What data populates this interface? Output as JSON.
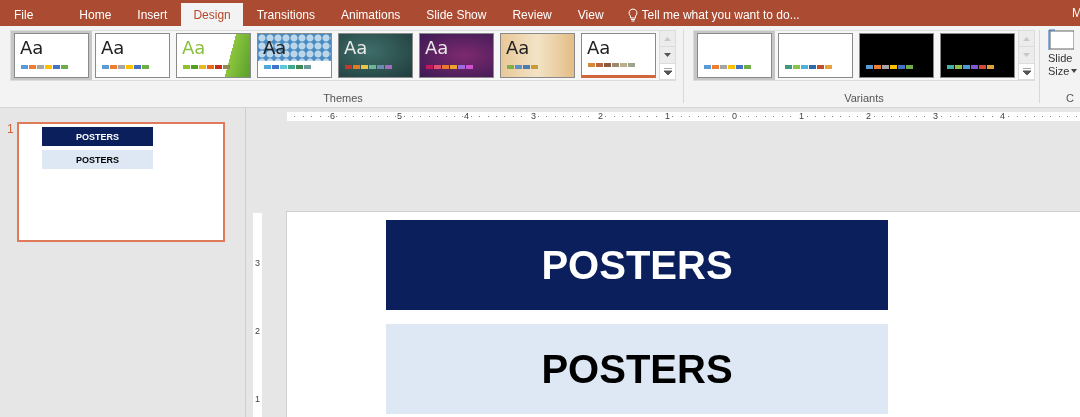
{
  "tabs": [
    {
      "label": "File",
      "selected": false
    },
    {
      "label": "Home",
      "selected": false
    },
    {
      "label": "Insert",
      "selected": false
    },
    {
      "label": "Design",
      "selected": true
    },
    {
      "label": "Transitions",
      "selected": false
    },
    {
      "label": "Animations",
      "selected": false
    },
    {
      "label": "Slide Show",
      "selected": false
    },
    {
      "label": "Review",
      "selected": false
    },
    {
      "label": "View",
      "selected": false
    }
  ],
  "tell_me": {
    "placeholder": "Tell me what you want to do..."
  },
  "account_cut": "M",
  "themes": {
    "label": "Themes",
    "items": [
      {
        "kind": "plain",
        "aa": "Aa",
        "selected": true,
        "swatches": [
          {
            "color": "#5b9bd5"
          },
          {
            "color": "#ed7d31"
          },
          {
            "color": "#a5a5a5"
          },
          {
            "color": "#ffc000"
          },
          {
            "color": "#4472c4"
          },
          {
            "color": "#70ad47"
          }
        ]
      },
      {
        "kind": "plain",
        "aa": "Aa",
        "selected": false,
        "swatches": [
          {
            "color": "#5b9bd5"
          },
          {
            "color": "#ed7d31"
          },
          {
            "color": "#a5a5a5"
          },
          {
            "color": "#ffc000"
          },
          {
            "color": "#4472c4"
          },
          {
            "color": "#70ad47"
          }
        ]
      },
      {
        "kind": "facet",
        "aa": "Aa",
        "selected": false,
        "swatches": [
          {
            "color": "#90c226"
          },
          {
            "color": "#54a021"
          },
          {
            "color": "#e6b91e"
          },
          {
            "color": "#e76618"
          },
          {
            "color": "#c42f1a"
          },
          {
            "color": "#918655"
          }
        ]
      },
      {
        "kind": "pattern",
        "aa": "Aa",
        "selected": false,
        "swatches": [
          {
            "color": "#4ea6dc"
          },
          {
            "color": "#3f76c9"
          },
          {
            "color": "#5fc8d7"
          },
          {
            "color": "#3fa98b"
          },
          {
            "color": "#3e8853"
          },
          {
            "color": "#6b9a9a"
          }
        ]
      },
      {
        "kind": "teal",
        "aa": "Aa",
        "selected": false,
        "swatches": [
          {
            "color": "#c0392b"
          },
          {
            "color": "#e07b26"
          },
          {
            "color": "#e8c547"
          },
          {
            "color": "#6fb596"
          },
          {
            "color": "#6a8bb0"
          },
          {
            "color": "#a36dbd"
          }
        ]
      },
      {
        "kind": "purple",
        "aa": "Aa",
        "selected": false,
        "swatches": [
          {
            "color": "#c2185b"
          },
          {
            "color": "#e05070"
          },
          {
            "color": "#e87830"
          },
          {
            "color": "#f0a030"
          },
          {
            "color": "#9a6ee0"
          },
          {
            "color": "#d050d0"
          }
        ]
      },
      {
        "kind": "wood",
        "aa": "Aa",
        "selected": false,
        "swatches": [
          {
            "color": "#7fae4a"
          },
          {
            "color": "#5b8fc8"
          },
          {
            "color": "#4a7ab0"
          },
          {
            "color": "#c89b3c"
          }
        ]
      },
      {
        "kind": "brown",
        "aa": "Aa",
        "selected": false,
        "swatches": [
          {
            "color": "#d08a38"
          },
          {
            "color": "#b8643c"
          },
          {
            "color": "#8b5a3c"
          },
          {
            "color": "#998c6c"
          },
          {
            "color": "#b9b08b"
          },
          {
            "color": "#a0a48c"
          }
        ]
      }
    ]
  },
  "variants": {
    "label": "Variants",
    "items": [
      {
        "kind": "white",
        "selected": true,
        "swatches": [
          {
            "color": "#5b9bd5"
          },
          {
            "color": "#ed7d31"
          },
          {
            "color": "#a5a5a5"
          },
          {
            "color": "#ffc000"
          },
          {
            "color": "#4472c4"
          },
          {
            "color": "#70ad47"
          }
        ]
      },
      {
        "kind": "white",
        "selected": false,
        "swatches": [
          {
            "color": "#3e9a7d"
          },
          {
            "color": "#8bc34a"
          },
          {
            "color": "#4fb3d9"
          },
          {
            "color": "#2d6aa8"
          },
          {
            "color": "#c0502a"
          },
          {
            "color": "#e8a23a"
          }
        ]
      },
      {
        "kind": "black",
        "selected": false,
        "swatches": [
          {
            "color": "#5b9bd5"
          },
          {
            "color": "#ed7d31"
          },
          {
            "color": "#a5a5a5"
          },
          {
            "color": "#ffc000"
          },
          {
            "color": "#4472c4"
          },
          {
            "color": "#70ad47"
          }
        ]
      },
      {
        "kind": "black",
        "selected": false,
        "swatches": [
          {
            "color": "#4ab0a0"
          },
          {
            "color": "#8bc34a"
          },
          {
            "color": "#4a9ad5"
          },
          {
            "color": "#7a5ad0"
          },
          {
            "color": "#d04a3a"
          },
          {
            "color": "#e0a040"
          }
        ]
      }
    ]
  },
  "slide_size": {
    "line1": "Slide",
    "line2": "Size",
    "group_cut": "C"
  },
  "slides": [
    {
      "number": "1",
      "selected": true,
      "boxes": [
        {
          "kind": "dark",
          "text": "POSTERS"
        },
        {
          "kind": "light",
          "text": "POSTERS"
        }
      ]
    }
  ],
  "ruler": {
    "horizontal": [
      "6",
      "5",
      "4",
      "3",
      "2",
      "1",
      "0",
      "1",
      "2",
      "3",
      "4"
    ],
    "vertical": [
      "3",
      "2",
      "1"
    ]
  },
  "canvas": {
    "boxes": [
      {
        "kind": "dark",
        "text": "POSTERS"
      },
      {
        "kind": "light",
        "text": "POSTERS"
      }
    ]
  }
}
